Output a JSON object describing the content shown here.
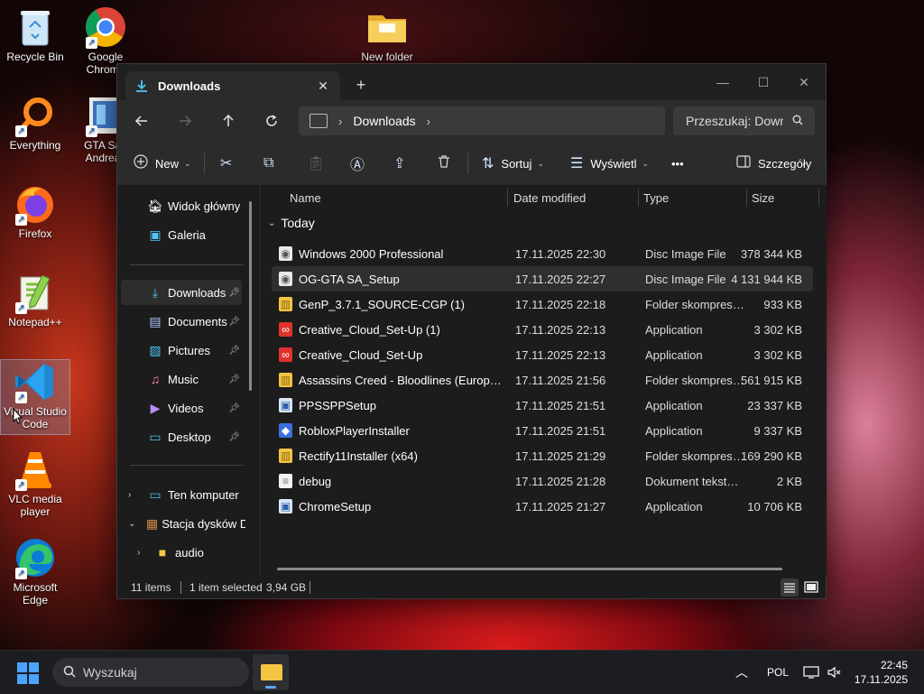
{
  "desktop": {
    "icons": [
      {
        "label": "Recycle Bin"
      },
      {
        "label": "Google Chrome"
      },
      {
        "label": "New folder"
      },
      {
        "label": "Everything"
      },
      {
        "label": "GTA San Andreas"
      },
      {
        "label": "Firefox"
      },
      {
        "label": "Notepad++"
      },
      {
        "label": "Visual Studio Code"
      },
      {
        "label": "VLC media player"
      },
      {
        "label": "Microsoft Edge"
      }
    ]
  },
  "window": {
    "tab_title": "Downloads",
    "tab_close": "✕",
    "new_tab": "+",
    "controls": {
      "minimize": "—",
      "maximize": "☐",
      "close": "✕"
    },
    "address": {
      "segment": "Downloads"
    },
    "search": {
      "placeholder": "Przeszukaj: Downloads"
    },
    "toolbar": {
      "new_label": "New",
      "sort_label": "Sortuj",
      "view_label": "Wyświetl",
      "more_label": "•••",
      "details_label": "Szczegóły"
    },
    "sidebar": {
      "items": [
        {
          "label": "Widok główny",
          "icon": "home-icon"
        },
        {
          "label": "Galeria",
          "icon": "gallery-icon"
        },
        {
          "label": "Downloads",
          "icon": "download-icon",
          "pinned": true
        },
        {
          "label": "Documents",
          "icon": "documents-icon",
          "pinned": true
        },
        {
          "label": "Pictures",
          "icon": "pictures-icon",
          "pinned": true
        },
        {
          "label": "Music",
          "icon": "music-icon",
          "pinned": true
        },
        {
          "label": "Videos",
          "icon": "videos-icon",
          "pinned": true
        },
        {
          "label": "Desktop",
          "icon": "desktop-icon",
          "pinned": true
        },
        {
          "label": "Ten komputer",
          "icon": "computer-icon"
        },
        {
          "label": "Stacja dysków D",
          "icon": "drive-icon"
        },
        {
          "label": "audio",
          "icon": "folder-icon"
        }
      ]
    },
    "columns": {
      "name": "Name",
      "date": "Date modified",
      "type": "Type",
      "size": "Size"
    },
    "group_label": "Today",
    "files": [
      {
        "name": "Windows 2000 Professional",
        "date": "17.11.2025 22:30",
        "type": "Disc Image File",
        "size": "378 344 KB",
        "icon": "disc-image-icon"
      },
      {
        "name": "OG-GTA SA_Setup",
        "date": "17.11.2025 22:27",
        "type": "Disc Image File",
        "size": "4 131 944 KB",
        "icon": "disc-image-icon"
      },
      {
        "name": "GenP_3.7.1_SOURCE-CGP (1)",
        "date": "17.11.2025 22:18",
        "type": "Folder skompresowany",
        "size": "933 KB",
        "icon": "zip-folder-icon"
      },
      {
        "name": "Creative_Cloud_Set-Up (1)",
        "date": "17.11.2025 22:13",
        "type": "Application",
        "size": "3 302 KB",
        "icon": "creative-cloud-icon"
      },
      {
        "name": "Creative_Cloud_Set-Up",
        "date": "17.11.2025 22:13",
        "type": "Application",
        "size": "3 302 KB",
        "icon": "creative-cloud-icon"
      },
      {
        "name": "Assassins Creed - Bloodlines (Europe) (En...",
        "date": "17.11.2025 21:56",
        "type": "Folder skompresowany",
        "size": "561 915 KB",
        "icon": "zip-folder-icon"
      },
      {
        "name": "PPSSPPSetup",
        "date": "17.11.2025 21:51",
        "type": "Application",
        "size": "23 337 KB",
        "icon": "app-icon"
      },
      {
        "name": "RobloxPlayerInstaller",
        "date": "17.11.2025 21:51",
        "type": "Application",
        "size": "9 337 KB",
        "icon": "roblox-icon"
      },
      {
        "name": "Rectify11Installer (x64)",
        "date": "17.11.2025 21:29",
        "type": "Folder skompresowany",
        "size": "169 290 KB",
        "icon": "zip-folder-icon"
      },
      {
        "name": "debug",
        "date": "17.11.2025 21:28",
        "type": "Dokument tekstowy",
        "size": "2 KB",
        "icon": "text-file-icon"
      },
      {
        "name": "ChromeSetup",
        "date": "17.11.2025 21:27",
        "type": "Application",
        "size": "10 706 KB",
        "icon": "app-icon"
      }
    ],
    "status": {
      "count": "11 items",
      "selected": "1 item selected",
      "size": "3,94 GB"
    }
  },
  "taskbar": {
    "search_placeholder": "Wyszukaj",
    "language": "POL",
    "time": "22:45",
    "date": "17.11.2025"
  },
  "colors": {
    "accent": "#4fc3f7",
    "folder": "#f5c443",
    "selected_row": "#2f2f2f"
  }
}
